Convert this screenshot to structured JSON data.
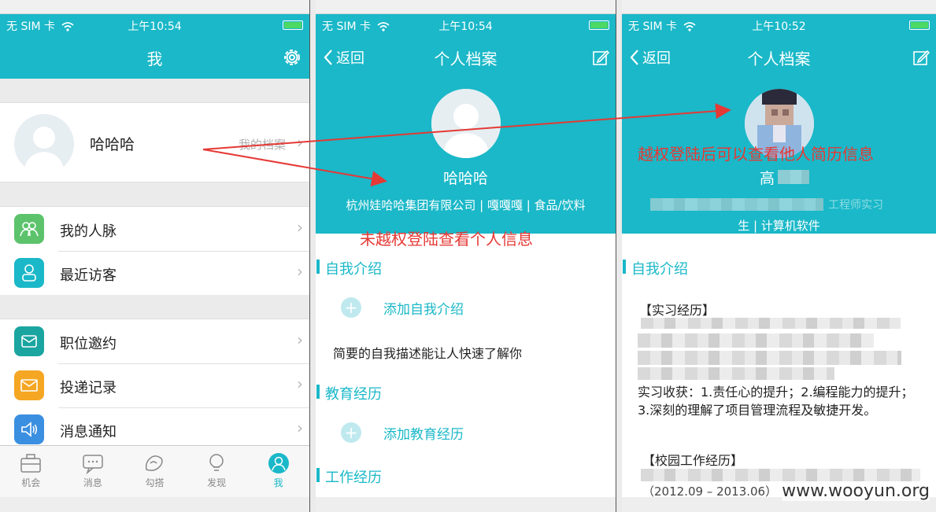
{
  "status": {
    "carrier": "无 SIM 卡",
    "time_p1": "上午10:54",
    "time_p2": "上午10:54",
    "time_p3": "上午10:52"
  },
  "p1": {
    "title": "我",
    "profile_name": "哈哈哈",
    "archive_link": "我的档案",
    "menu_group1": [
      "我的人脉",
      "最近访客"
    ],
    "menu_group2": [
      "职位邀约",
      "投递记录",
      "消息通知"
    ],
    "tabs": [
      "机会",
      "消息",
      "勾搭",
      "发现",
      "我"
    ]
  },
  "p2": {
    "back": "返回",
    "title": "个人档案",
    "name": "哈哈哈",
    "desc": "杭州娃哈哈集团有限公司 | 嘎嘎嘎 | 食品/饮料",
    "annotation": "未越权登陆查看个人信息",
    "section_intro": "自我介绍",
    "add_intro": "添加自我介绍",
    "intro_hint": "简要的自我描述能让人快速了解你",
    "section_edu": "教育经历",
    "add_edu": "添加教育经历",
    "section_work": "工作经历"
  },
  "p3": {
    "back": "返回",
    "title": "个人档案",
    "annotation": "越权登陆后可以查看他人简历信息",
    "name_partial": "高",
    "desc_line1_partial": "工程师实习",
    "desc_line2": "生 | 计算机软件",
    "section_intro": "自我介绍",
    "internship_heading": "【实习经历】",
    "internship_gain": "实习收获：1.责任心的提升；2.编程能力的提升；3.深刻的理解了项目管理流程及敏捷开发。",
    "campus_heading": "【校园工作经历】",
    "campus_dates": "（2012.09 – 2013.06）",
    "watermark": "www.wooyun.org"
  },
  "colors": {
    "brand": "#1ab8c8",
    "annotation": "#e53935",
    "icon_green": "#5cc36c",
    "icon_teal": "#1ab8c8",
    "icon_orange": "#f5a623",
    "icon_blue": "#3b8fe0"
  }
}
